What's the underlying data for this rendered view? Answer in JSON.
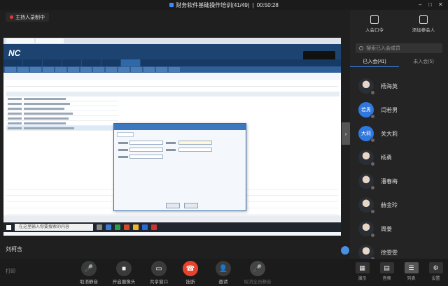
{
  "window": {
    "title": "财务软件基础操作培训(41/49)",
    "separator": "|",
    "timer": "00:50:28",
    "controls": [
      "–",
      "□",
      "✕"
    ]
  },
  "presenter_badge": "主持人录制中",
  "shared_screen": {
    "logo": "NC",
    "taskbar_search_placeholder": "在这里输入你要搜索的内容"
  },
  "speaker_name": "刘柯含",
  "fold_arrow": "›",
  "bottom_bar": {
    "network_label": "打印",
    "controls": [
      {
        "label": "取消静音",
        "icon": "🎤"
      },
      {
        "label": "开启摄像头",
        "icon": "■"
      },
      {
        "label": "共享窗口",
        "icon": "▭"
      },
      {
        "label": "挂断",
        "icon": "☎"
      },
      {
        "label": "邀请",
        "icon": "👤"
      },
      {
        "label": "取消全员静音",
        "icon": "🎤"
      }
    ]
  },
  "right_panel": {
    "invite_label": "入会口令",
    "add_member_label": "添加参会人",
    "search_placeholder": "搜索已入会成员",
    "tabs": [
      "已入会(41)",
      "未入会(5)"
    ],
    "members": [
      {
        "name": "杨海英",
        "avatar_text": "",
        "style": "photo"
      },
      {
        "name": "闫若男",
        "avatar_text": "若男",
        "style": "blue"
      },
      {
        "name": "关大莉",
        "avatar_text": "大莉",
        "style": "blue"
      },
      {
        "name": "杨勇",
        "avatar_text": "",
        "style": "photo"
      },
      {
        "name": "潘春梅",
        "avatar_text": "",
        "style": "photo"
      },
      {
        "name": "赫金玲",
        "avatar_text": "",
        "style": "photo"
      },
      {
        "name": "周姜",
        "avatar_text": "",
        "style": "photo"
      },
      {
        "name": "徐雯雯",
        "avatar_text": "",
        "style": "photo"
      }
    ],
    "bottom": [
      {
        "label": "演示",
        "icon": "▦"
      },
      {
        "label": "音频",
        "icon": "▤"
      },
      {
        "label": "列表",
        "icon": "☰"
      },
      {
        "label": "设置",
        "icon": "⚙"
      }
    ]
  }
}
